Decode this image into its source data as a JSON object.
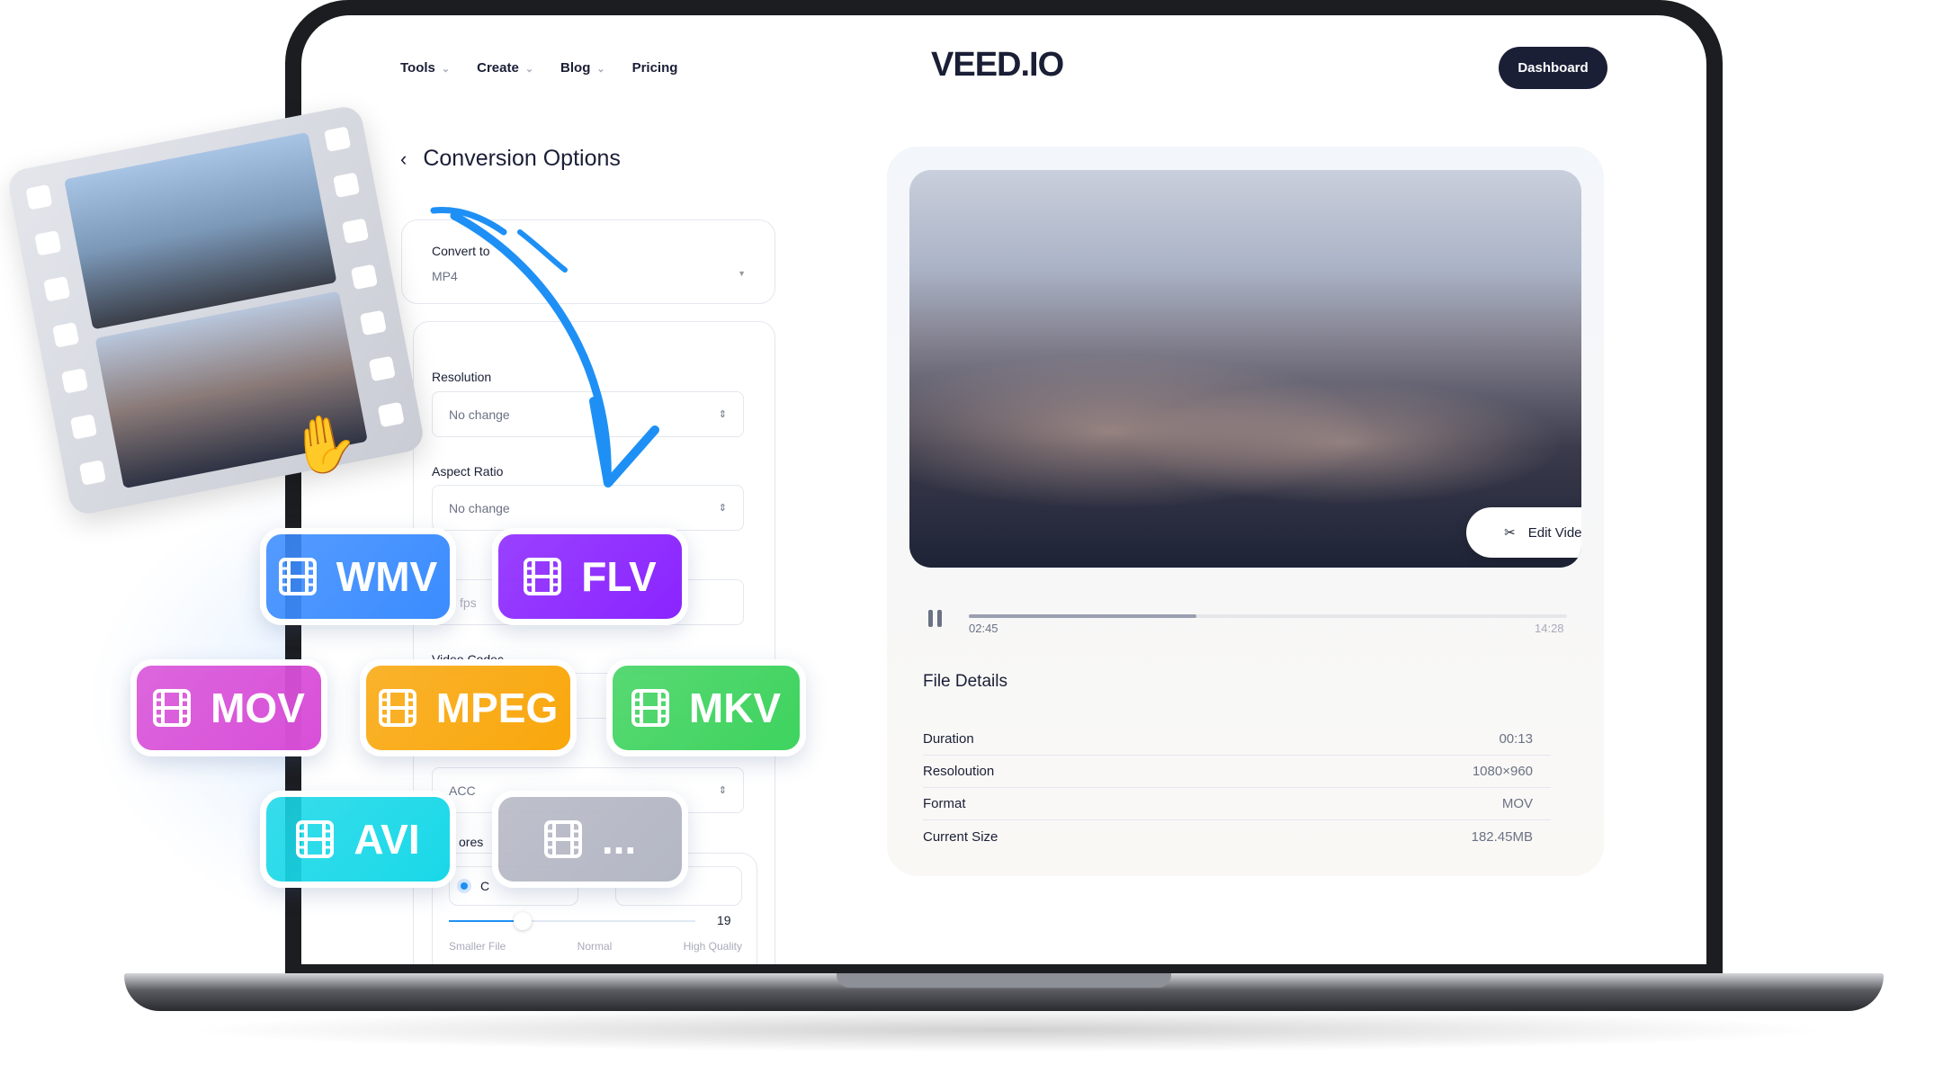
{
  "nav": {
    "items": [
      {
        "label": "Tools",
        "dropdown": true
      },
      {
        "label": "Create",
        "dropdown": true
      },
      {
        "label": "Blog",
        "dropdown": true
      },
      {
        "label": "Pricing",
        "dropdown": false
      }
    ],
    "logo": "VEED.IO",
    "dashboard": "Dashboard"
  },
  "conversion": {
    "title": "Conversion Options",
    "convert_label": "Convert to",
    "convert_value": "MP4",
    "resolution_label": "Resolution",
    "resolution_value": "No change",
    "aspect_label": "Aspect Ratio",
    "aspect_value": "No change",
    "fps_value": "fps",
    "video_codec_label": "Video Codec",
    "audio_value": "ACC",
    "compression_label": "ores",
    "radio_label": "C",
    "slider_value": "19",
    "slider_fraction": 0.3,
    "slider_labels": [
      "Smaller File",
      "Normal",
      "High Quality"
    ]
  },
  "player": {
    "edit": "Edit Video",
    "current": "02:45",
    "total": "14:28",
    "progress": 0.38
  },
  "file_details": {
    "title": "File Details",
    "rows": [
      {
        "label": "Duration",
        "value": "00:13"
      },
      {
        "label": "Resoloution",
        "value": "1080×960"
      },
      {
        "label": "Format",
        "value": "MOV"
      },
      {
        "label": "Current Size",
        "value": "182.45MB"
      }
    ]
  },
  "formats": [
    {
      "label": "WMV",
      "color": "#3b8cff"
    },
    {
      "label": "FLV",
      "color": "#8a24ff"
    },
    {
      "label": "MOV",
      "color": "#d84fd8"
    },
    {
      "label": "MPEG",
      "color": "#f9a70c"
    },
    {
      "label": "MKV",
      "color": "#3ed35e"
    },
    {
      "label": "AVI",
      "color": "#19d8e8"
    },
    {
      "label": "...",
      "color": "#b4b7c4"
    }
  ],
  "accent": "#1e90f5"
}
